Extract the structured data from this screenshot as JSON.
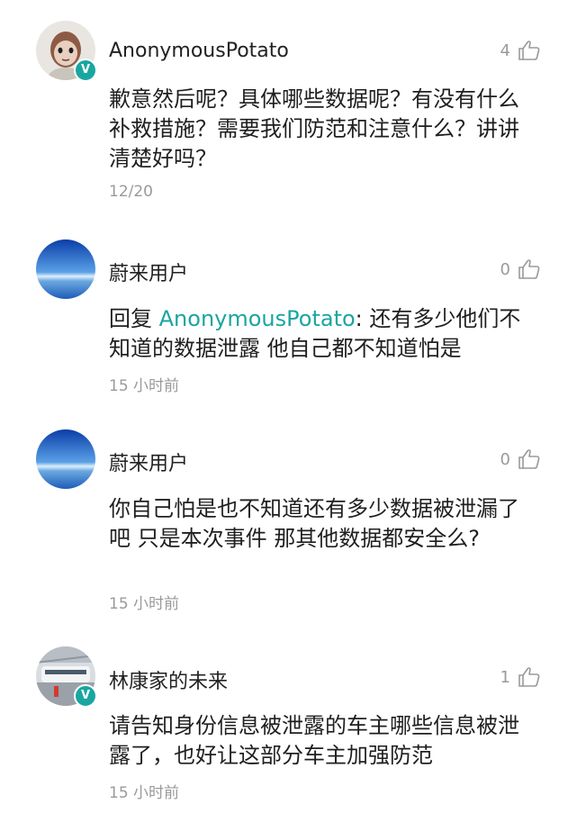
{
  "comments": [
    {
      "username": "AnonymousPotato",
      "likes": "4",
      "text": "歉意然后呢？具体哪些数据呢？有没有什么补救措施？需要我们防范和注意什么？讲讲清楚好吗？",
      "time": "12/20",
      "avatar": "figurine-avatar",
      "verified": "V"
    },
    {
      "username": "蔚来用户",
      "likes": "0",
      "reply_prefix": "回复 ",
      "mention": "AnonymousPotato",
      "text": ": 还有多少他们不知道的数据泄露 他自己都不知道怕是",
      "time": "15 小时前",
      "avatar": "sky-avatar"
    },
    {
      "username": "蔚来用户",
      "likes": "0",
      "text": "你自己怕是也不知道还有多少数据被泄漏了吧 只是本次事件 那其他数据都安全么?",
      "time": "15 小时前",
      "avatar": "sky-avatar"
    },
    {
      "username": "林康家的未来",
      "likes": "1",
      "text": "请告知身份信息被泄露的车主哪些信息被泄露了，也好让这部分车主加强防范",
      "time": "15 小时前",
      "avatar": "train-station-avatar",
      "verified": "V"
    }
  ],
  "colors": {
    "accent": "#1aa6a0",
    "muted": "#9a9a9a",
    "text": "#1f1f1f"
  }
}
